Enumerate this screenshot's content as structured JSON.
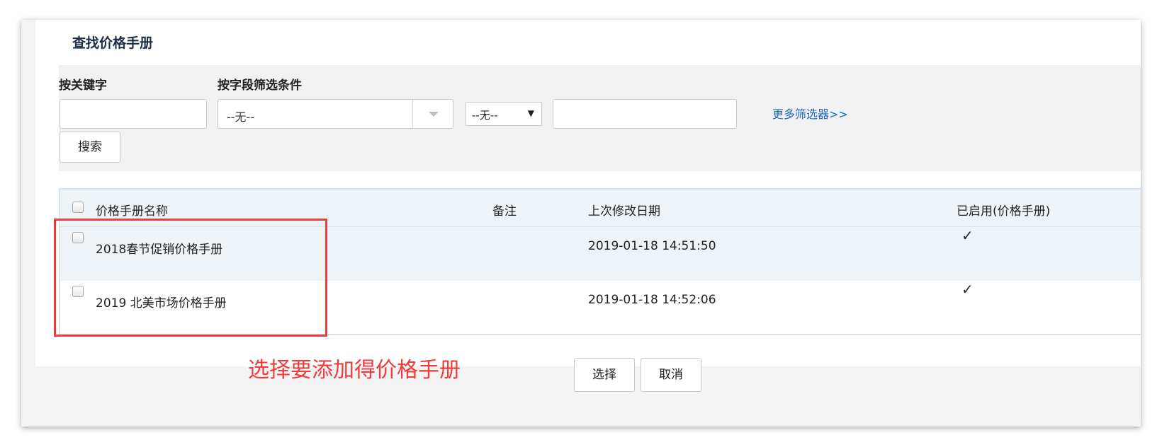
{
  "dialog": {
    "title": "查找价格手册"
  },
  "filter": {
    "keyword_label": "按关键字",
    "keyword_value": "",
    "field_filter_label": "按字段筛选条件",
    "field_select_value": "--无--",
    "operator_select_value": "--无--",
    "value_input": "",
    "more_filters_link": "更多筛选器>>",
    "search_button": "搜索"
  },
  "table": {
    "columns": [
      "价格手册名称",
      "备注",
      "上次修改日期",
      "已启用(价格手册)"
    ],
    "rows": [
      {
        "name": "2018春节促销价格手册",
        "note": "",
        "modified": "2019-01-18 14:51:50",
        "enabled": "✓"
      },
      {
        "name": "2019 北美市场价格手册",
        "note": "",
        "modified": "2019-01-18 14:52:06",
        "enabled": "✓"
      }
    ]
  },
  "annotation": {
    "text": "选择要添加得价格手册",
    "color": "#ee3b3b"
  },
  "footer": {
    "select_button": "选择",
    "cancel_button": "取消"
  },
  "colors": {
    "title": "#1f2e45",
    "link": "#1e6bb8",
    "header_bg": "#eef3f7"
  }
}
